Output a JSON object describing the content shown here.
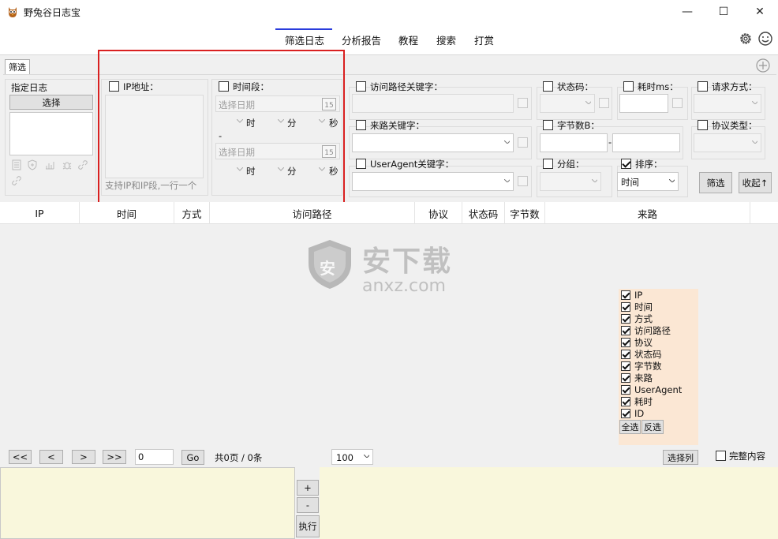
{
  "window": {
    "title": "野兔谷日志宝",
    "controls": {
      "minimize": "—",
      "maximize": "☐",
      "close": "✕"
    }
  },
  "menu": {
    "items": [
      "筛选日志",
      "分析报告",
      "教程",
      "搜索",
      "打赏"
    ],
    "active": "筛选日志"
  },
  "tabs": {
    "filter": "筛选"
  },
  "log_panel": {
    "title": "指定日志",
    "select_button": "选择"
  },
  "ip_filter": {
    "label": "IP地址：",
    "hint": "支持IP和IP段,一行一个"
  },
  "time_filter": {
    "label": "时间段：",
    "date_placeholder": "选择日期",
    "calendar_day": "15",
    "hour_unit": "时",
    "minute_unit": "分",
    "second_unit": "秒",
    "separator": "-"
  },
  "filters": {
    "path_keyword": "访问路径关键字：",
    "referer_keyword": "来路关键字：",
    "useragent_keyword": "UserAgent关键字：",
    "status_code": "状态码：",
    "bytes": "字节数B：",
    "bytes_separator": "-",
    "group": "分组：",
    "elapsed": "耗时ms：",
    "sort": "排序：",
    "sort_value": "时间",
    "method": "请求方式：",
    "protocol": "协议类型："
  },
  "actions": {
    "filter_button": "筛选",
    "collapse_button": "收起↑"
  },
  "table": {
    "columns": [
      "IP",
      "时间",
      "方式",
      "访问路径",
      "协议",
      "状态码",
      "字节数",
      "来路"
    ]
  },
  "watermark": {
    "brand": "安下载",
    "domain": "anxz.com",
    "badge": "安"
  },
  "column_chooser": {
    "items": [
      "IP",
      "时间",
      "方式",
      "访问路径",
      "协议",
      "状态码",
      "字节数",
      "来路",
      "UserAgent",
      "耗时",
      "ID"
    ],
    "select_all": "全选",
    "invert": "反选"
  },
  "pager": {
    "first": "<<",
    "prev": "<",
    "next": ">",
    "last": ">>",
    "page_input": "0",
    "go": "Go",
    "summary": "共0页 / 0条",
    "page_size": "100",
    "choose_columns": "选择列",
    "full_content": "完整内容"
  },
  "bottom": {
    "plus": "+",
    "minus": "-",
    "execute": "执行"
  },
  "colors": {
    "accent_underline": "#2a3cdc",
    "highlight_border": "#d92020",
    "chooser_bg": "#fbe7d4",
    "bottom_bg": "#f9f7dc"
  }
}
